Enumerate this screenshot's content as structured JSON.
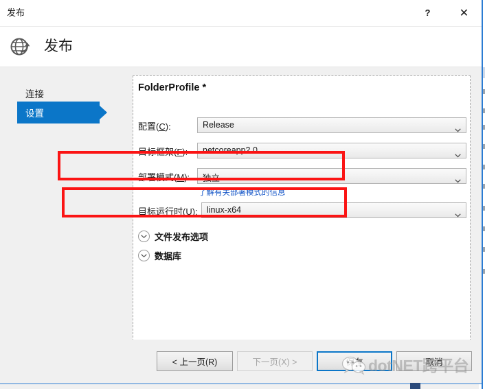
{
  "window": {
    "title": "发布",
    "help_label": "?",
    "close_label": "✕"
  },
  "header": {
    "title": "发布",
    "icon": "globe-publish-icon"
  },
  "sidebar": {
    "items": [
      {
        "label": "连接",
        "selected": false
      },
      {
        "label": "设置",
        "selected": true
      }
    ]
  },
  "panel": {
    "title": "FolderProfile *",
    "fields": [
      {
        "label_prefix": "配置(",
        "label_key": "C",
        "label_suffix": "):",
        "value": "Release",
        "name": "configuration"
      },
      {
        "label_prefix": "目标框架(",
        "label_key": "F",
        "label_suffix": "):",
        "value": "netcoreapp2.0",
        "name": "target-framework"
      },
      {
        "label_prefix": "部署模式(",
        "label_key": "M",
        "label_suffix": "):",
        "value": "独立",
        "name": "deployment-mode"
      },
      {
        "label_prefix": "目标运行时(",
        "label_key": "U",
        "label_suffix": "):",
        "value": "linux-x64",
        "name": "target-runtime"
      }
    ],
    "hint_link": "了解有关部署模式的信息",
    "expanders": [
      {
        "label": "文件发布选项",
        "name": "file-publish-options"
      },
      {
        "label": "数据库",
        "name": "database"
      }
    ]
  },
  "footer": {
    "prev_label": "< 上一页(R)",
    "next_label": "下一页(X) >",
    "save_label": "保存",
    "cancel_label": "取消"
  },
  "watermark": {
    "text": "dotNET跨平台"
  },
  "colors": {
    "accent": "#0b76c8",
    "annotation": "#fb1414",
    "link": "#1657c8",
    "window_border": "#2b7cd3"
  }
}
